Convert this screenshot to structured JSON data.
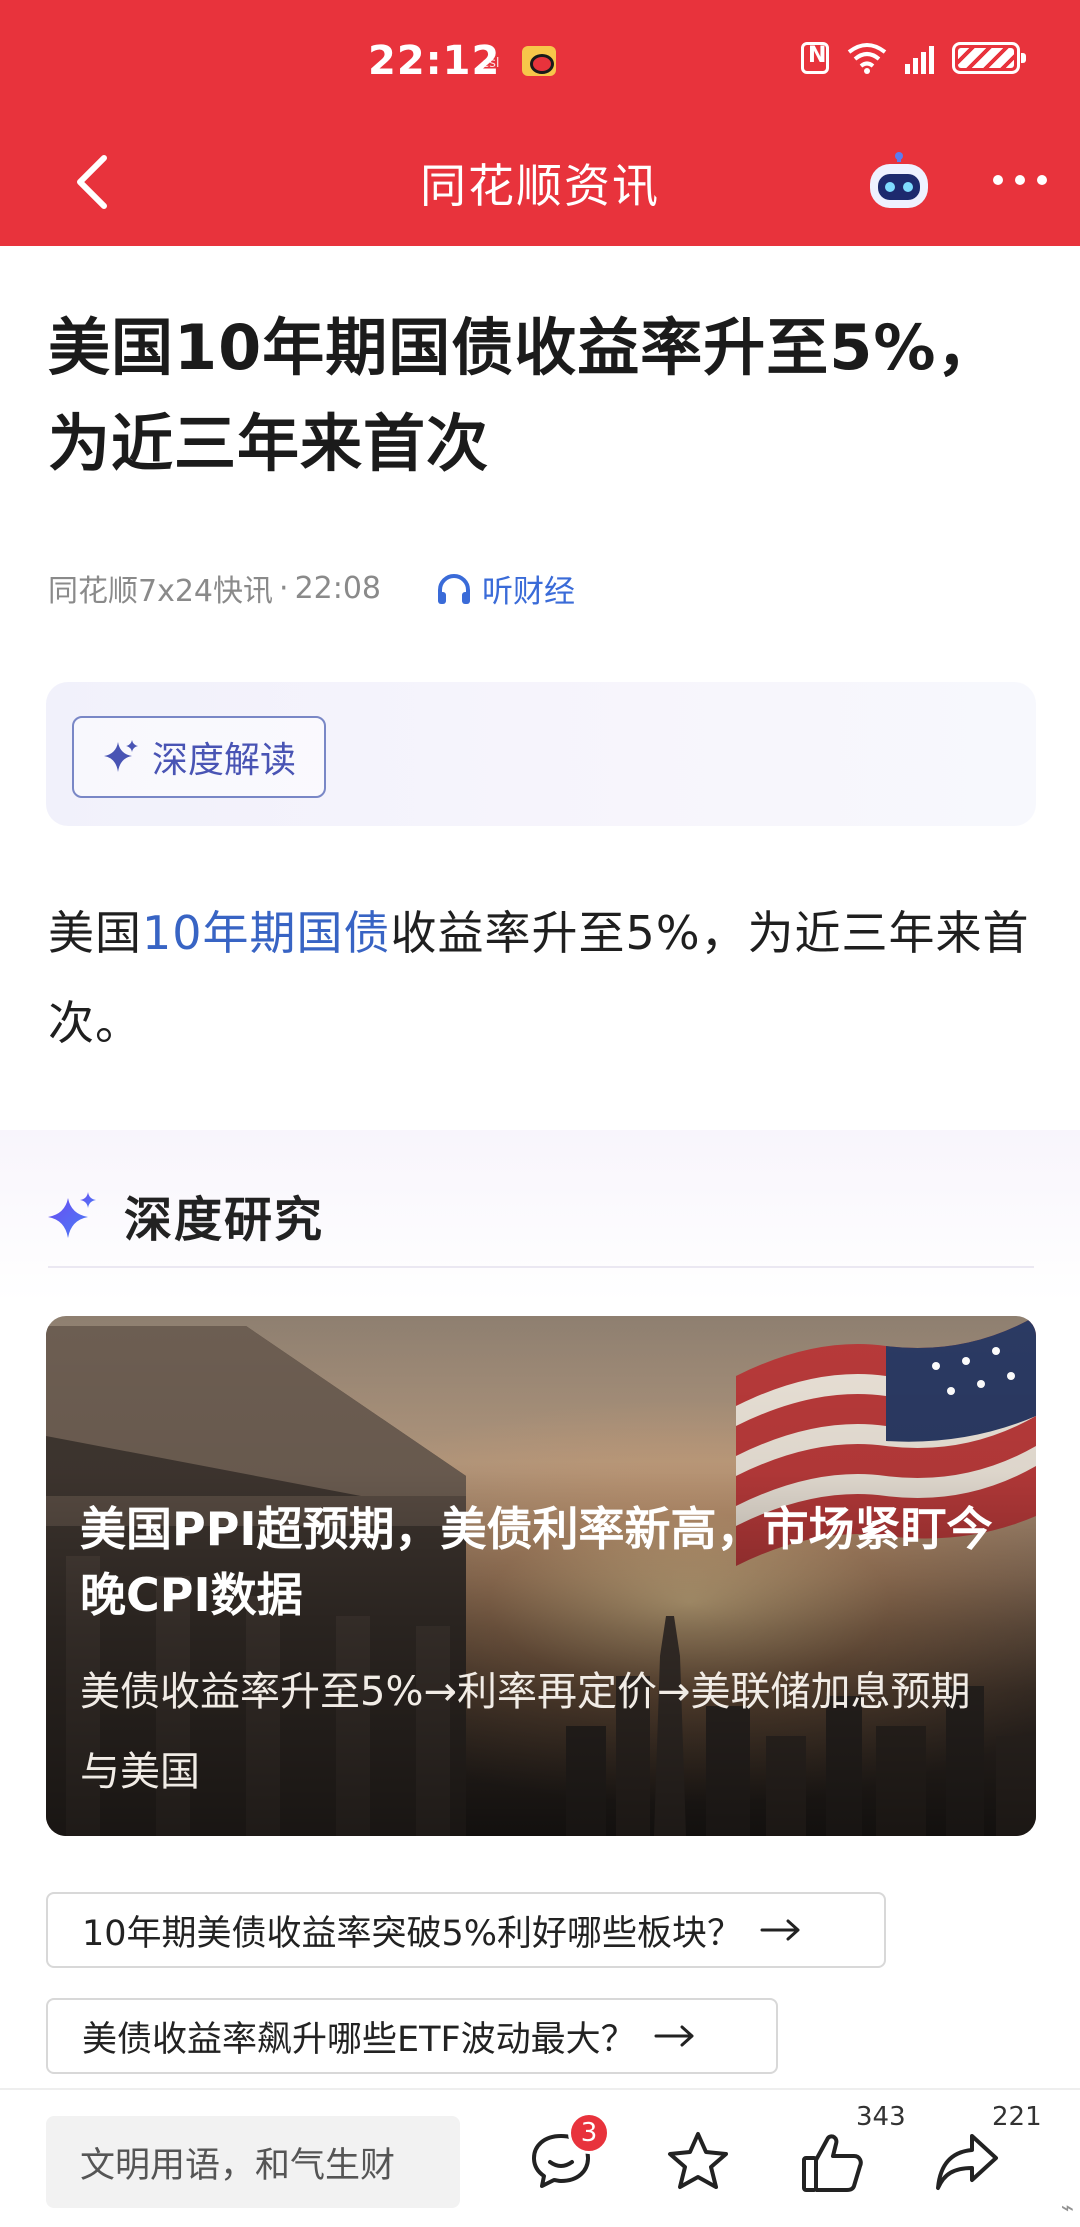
{
  "status_bar": {
    "time": "22:12",
    "mini_label": "csl"
  },
  "nav": {
    "title": "同花顺资讯"
  },
  "article": {
    "title": "美国10年期国债收益率升至5%，为近三年来首次",
    "source": "同花顺7x24快讯",
    "time": "22:08",
    "listen_label": "听财经",
    "deep_read_label": "深度解读",
    "body_prefix": "美国",
    "body_link": "10年期国债",
    "body_suffix": "收益率升至5%，为近三年来首次。"
  },
  "research": {
    "section_title": "深度研究",
    "card": {
      "title": "美国PPI超预期，美债利率新高，市场紧盯今晚CPI数据",
      "description": "美债收益率升至5%→利率再定价→美联储加息预期与美国"
    },
    "questions": [
      "10年期美债收益率突破5%利好哪些板块？",
      "美债收益率飙升哪些ETF波动最大？"
    ]
  },
  "bottom_bar": {
    "comment_placeholder": "文明用语，和气生财",
    "comment_badge": "3",
    "like_count": "343",
    "share_count": "221"
  },
  "colors": {
    "brand_red": "#e8333c",
    "link_blue": "#3864c4",
    "deep_read_purple": "#4954b4"
  }
}
